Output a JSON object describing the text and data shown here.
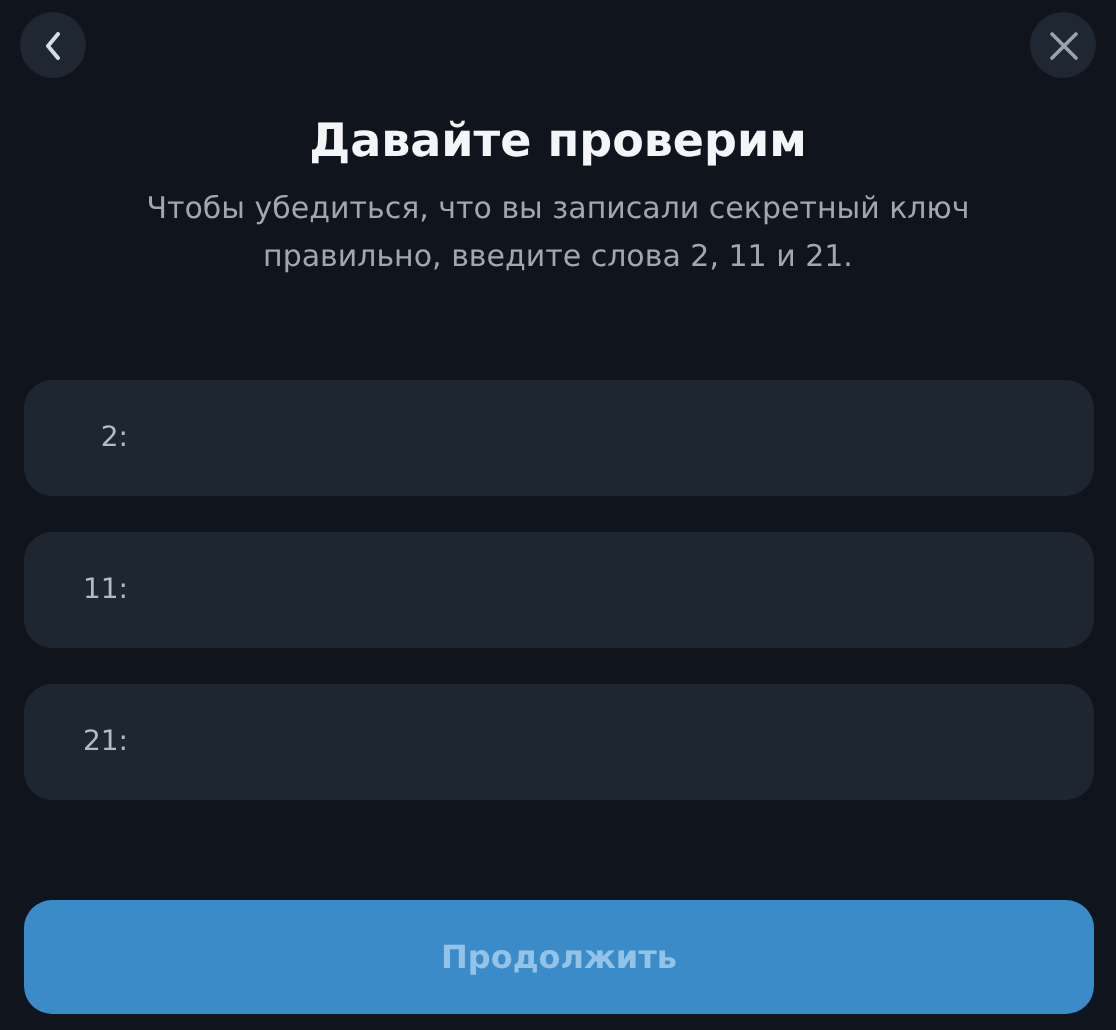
{
  "title": "Давайте проверим",
  "subtitle": "Чтобы убедиться, что вы записали секретный ключ правильно, введите слова 2, 11 и 21.",
  "fields": [
    {
      "label": "2:"
    },
    {
      "label": "11:"
    },
    {
      "label": "21:"
    }
  ],
  "button": {
    "label": "Продолжить",
    "disabled": true
  }
}
